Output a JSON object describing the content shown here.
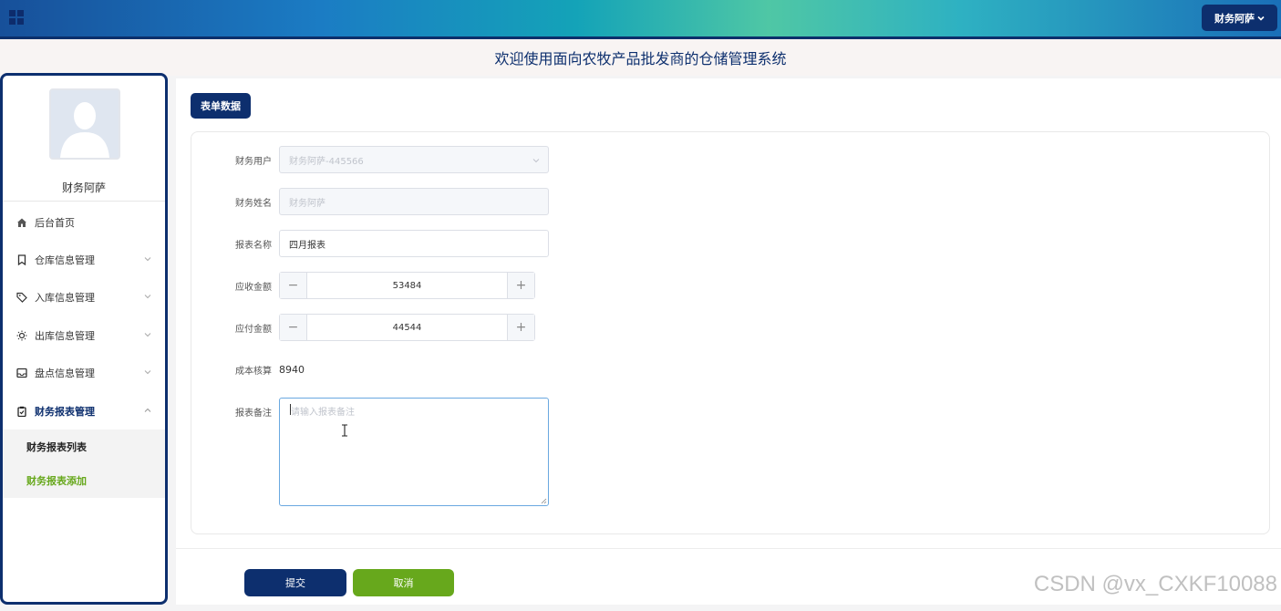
{
  "topbar": {
    "grid_icon": "grid-icon",
    "user_menu_label": "财务阿萨",
    "user_menu_icon": "chevron-down-icon"
  },
  "header": {
    "title": "欢迎使用面向农牧产品批发商的仓储管理系统"
  },
  "sidebar": {
    "avatar_icon": "user-avatar-icon",
    "user_name": "财务阿萨",
    "items": [
      {
        "label": "后台首页",
        "icon": "home-icon"
      },
      {
        "label": "仓库信息管理",
        "icon": "bookmark-icon"
      },
      {
        "label": "入库信息管理",
        "icon": "tag-icon"
      },
      {
        "label": "出库信息管理",
        "icon": "sun-icon"
      },
      {
        "label": "盘点信息管理",
        "icon": "inbox-icon"
      },
      {
        "label": "财务报表管理",
        "icon": "clipboard-check-icon"
      }
    ],
    "subitems": [
      {
        "label": "财务报表列表"
      },
      {
        "label": "财务报表添加"
      }
    ]
  },
  "main": {
    "tag_label": "表单数据",
    "form": {
      "finance_user": {
        "label": "财务用户",
        "value": "财务阿萨-445566"
      },
      "finance_name": {
        "label": "财务姓名",
        "value": "财务阿萨"
      },
      "report_name": {
        "label": "报表名称",
        "value": "四月报表"
      },
      "receivable": {
        "label": "应收金额",
        "value": "53484"
      },
      "payable": {
        "label": "应付金额",
        "value": "44544"
      },
      "cost_check": {
        "label": "成本核算",
        "value": "8940"
      },
      "remark": {
        "label": "报表备注",
        "placeholder": "请输入报表备注"
      }
    },
    "submit_label": "提交",
    "cancel_label": "取消"
  },
  "watermark": "CSDN @vx_CXKF10088",
  "colors": {
    "primary": "#0d2f6e",
    "success": "#67a81c",
    "title": "#0d2f6e"
  }
}
